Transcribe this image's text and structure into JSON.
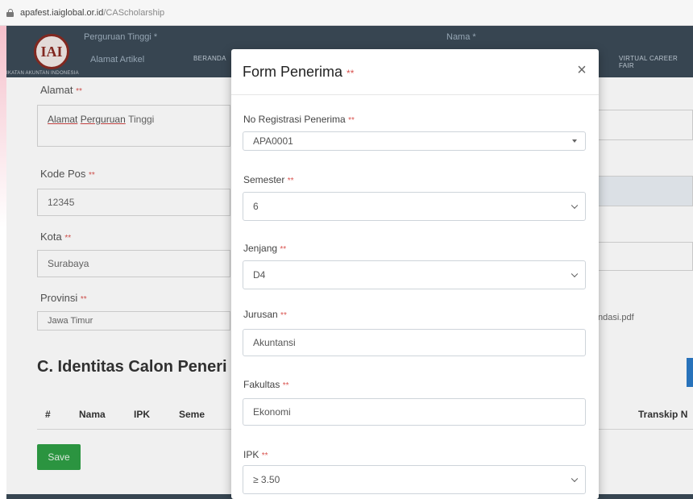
{
  "browser": {
    "url_host": "apafest.iaiglobal.or.id",
    "url_path": "/CAScholarship"
  },
  "navbar": {
    "logo_text": "IAI",
    "logo_caption": "IKATAN AKUNTAN INDONESIA",
    "field_left_1": "Perguruan Tinggi *",
    "field_left_2": "Alamat Artikel",
    "field_center": "Nama *",
    "link_beranda": "BERANDA",
    "link_virtual": "VIRTUAL CAREER FAIR"
  },
  "background_form": {
    "alamat_label": "Alamat",
    "alamat_link_1": "Alamat",
    "alamat_link_2": "Perguruan",
    "alamat_rest": "Tinggi",
    "kodepos_label": "Kode Pos",
    "kodepos_value": "12345",
    "kota_label": "Kota",
    "kota_value": "Surabaya",
    "provinsi_label": "Provinsi",
    "provinsi_value": "Jawa Timur",
    "file_name": "ndasi.pdf"
  },
  "section": {
    "title": "C. Identitas Calon Peneri",
    "columns": [
      "#",
      "Nama",
      "IPK",
      "Seme",
      "Transkip N"
    ],
    "save_label": "Save"
  },
  "modal": {
    "title": "Form Penerima",
    "required_mark": "**",
    "close_symbol": "×",
    "fields": [
      {
        "label": "No Registrasi Penerima",
        "value": "APA0001"
      },
      {
        "label": "Semester",
        "value": "6"
      },
      {
        "label": "Jenjang",
        "value": "D4"
      },
      {
        "label": "Jurusan",
        "value": "Akuntansi"
      },
      {
        "label": "Fakultas",
        "value": "Ekonomi"
      },
      {
        "label": "IPK",
        "value": "≥ 3.50"
      }
    ]
  },
  "colors": {
    "navbar": "#3b4a57",
    "required": "#d9534f",
    "save_button": "#2e9e44",
    "logo_red": "#8a2b22"
  }
}
